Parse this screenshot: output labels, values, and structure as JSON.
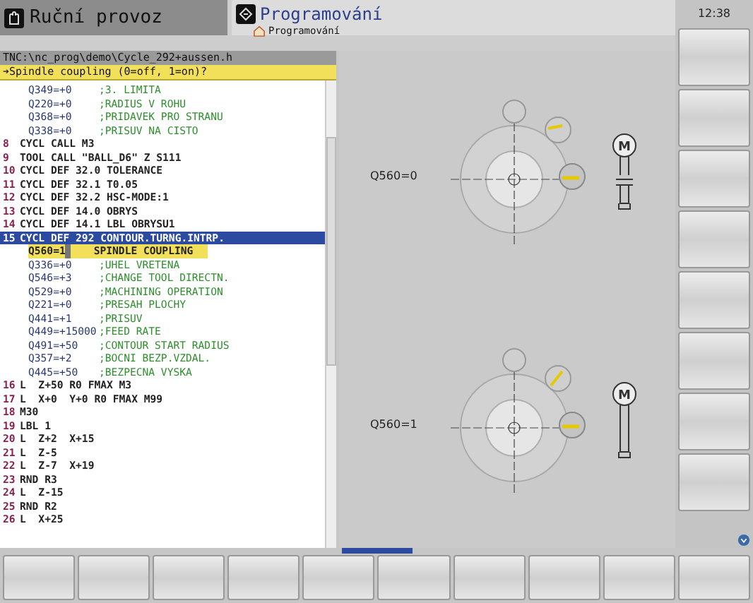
{
  "header": {
    "mode": "Ruční provoz",
    "program_mode": "Programování",
    "breadcrumb": "Programování"
  },
  "clock": "12:38",
  "program": {
    "path": "TNC:\\nc_prog\\demo\\Cycle_292+aussen.h",
    "prompt": "➔Spindle coupling (0=off, 1=on)?",
    "lines": [
      {
        "kind": "param",
        "code": "Q349=+0",
        "comment": ";3. LIMITA",
        "selected": false
      },
      {
        "kind": "param",
        "code": "Q220=+0",
        "comment": ";RADIUS V ROHU",
        "selected": false
      },
      {
        "kind": "param",
        "code": "Q368=+0",
        "comment": ";PRIDAVEK PRO STRANU",
        "selected": false
      },
      {
        "kind": "param",
        "code": "Q338=+0",
        "comment": ";PRISUV NA CISTO",
        "selected": false
      },
      {
        "kind": "block",
        "number": "8",
        "code": "CYCL CALL M3",
        "selected": false
      },
      {
        "kind": "block",
        "number": "9",
        "code": "TOOL CALL \"BALL_D6\" Z S111",
        "selected": false
      },
      {
        "kind": "block",
        "number": "10",
        "code": "CYCL DEF 32.0 TOLERANCE",
        "selected": false
      },
      {
        "kind": "block",
        "number": "11",
        "code": "CYCL DEF 32.1 T0.05",
        "selected": false
      },
      {
        "kind": "block",
        "number": "12",
        "code": "CYCL DEF 32.2 HSC-MODE:1",
        "selected": false
      },
      {
        "kind": "block",
        "number": "13",
        "code": "CYCL DEF 14.0 OBRYS",
        "selected": false
      },
      {
        "kind": "block",
        "number": "14",
        "code": "CYCL DEF 14.1 LBL OBRYSU1",
        "selected": false
      },
      {
        "kind": "block",
        "number": "15",
        "code": "CYCL DEF 292 CONTOUR.TURNG.INTRP.",
        "selected": true
      },
      {
        "kind": "input",
        "code": "Q560=1",
        "comment": "SPINDLE COUPLING",
        "selected": false
      },
      {
        "kind": "param",
        "code": "Q336=+0",
        "comment": ";UHEL VRETENA",
        "selected": false
      },
      {
        "kind": "param",
        "code": "Q546=+3",
        "comment": ";CHANGE TOOL DIRECTN.",
        "selected": false
      },
      {
        "kind": "param",
        "code": "Q529=+0",
        "comment": ";MACHINING OPERATION",
        "selected": false
      },
      {
        "kind": "param",
        "code": "Q221=+0",
        "comment": ";PRESAH PLOCHY",
        "selected": false
      },
      {
        "kind": "param",
        "code": "Q441=+1",
        "comment": ";PRISUV",
        "selected": false
      },
      {
        "kind": "param",
        "code": "Q449=+15000",
        "comment": ";FEED RATE",
        "selected": false
      },
      {
        "kind": "param",
        "code": "Q491=+50",
        "comment": ";CONTOUR START RADIUS",
        "selected": false
      },
      {
        "kind": "param",
        "code": "Q357=+2",
        "comment": ";BOCNI BEZP.VZDAL.",
        "selected": false
      },
      {
        "kind": "param",
        "code": "Q445=+50",
        "comment": ";BEZPECNA VYSKA",
        "selected": false
      },
      {
        "kind": "block",
        "number": "16",
        "code": "L  Z+50 R0 FMAX M3",
        "selected": false
      },
      {
        "kind": "block",
        "number": "17",
        "code": "L  X+0  Y+0 R0 FMAX M99",
        "selected": false
      },
      {
        "kind": "block",
        "number": "18",
        "code": "M30",
        "selected": false
      },
      {
        "kind": "block",
        "number": "19",
        "code": "LBL 1",
        "selected": false
      },
      {
        "kind": "block",
        "number": "20",
        "code": "L  Z+2  X+15",
        "selected": false
      },
      {
        "kind": "block",
        "number": "21",
        "code": "L  Z-5",
        "selected": false
      },
      {
        "kind": "block",
        "number": "22",
        "code": "L  Z-7  X+19",
        "selected": false
      },
      {
        "kind": "block",
        "number": "23",
        "code": "RND R3",
        "selected": false
      },
      {
        "kind": "block",
        "number": "24",
        "code": "L  Z-15",
        "selected": false
      },
      {
        "kind": "block",
        "number": "25",
        "code": "RND R2",
        "selected": false
      },
      {
        "kind": "block",
        "number": "26",
        "code": "L  X+25",
        "selected": false
      }
    ]
  },
  "help_graphic": {
    "diagrams": [
      {
        "label": "Q560=0",
        "motor_label": "M",
        "coupled": false
      },
      {
        "label": "Q560=1",
        "motor_label": "M",
        "coupled": true
      }
    ]
  }
}
